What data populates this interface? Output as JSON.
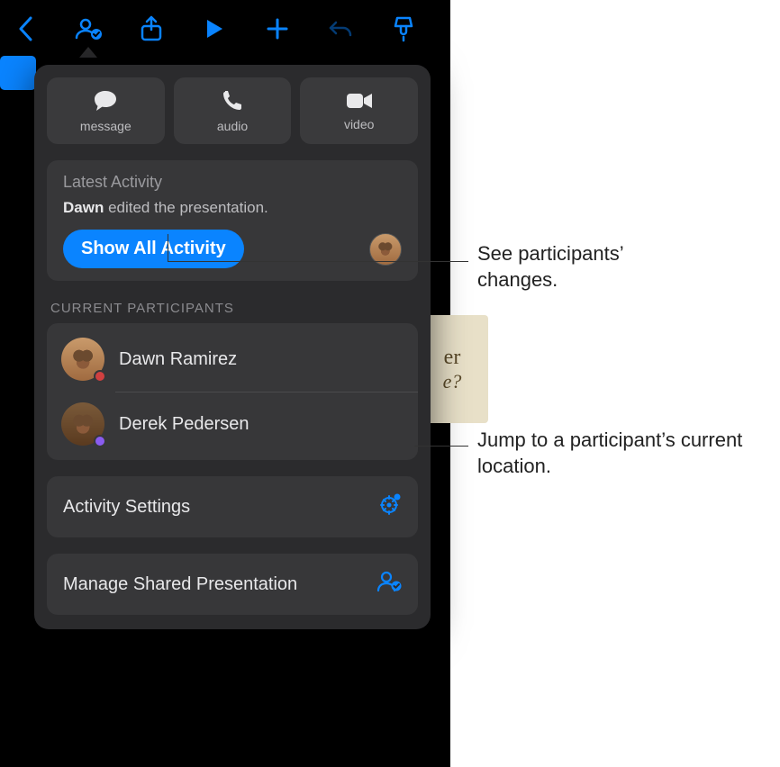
{
  "toolbar": {
    "back": "back",
    "collab": "collaboration",
    "share": "share",
    "play": "play",
    "add": "add",
    "undo": "undo",
    "format": "format-brush"
  },
  "popover": {
    "comms": [
      {
        "id": "message",
        "label": "message"
      },
      {
        "id": "audio",
        "label": "audio"
      },
      {
        "id": "video",
        "label": "video"
      }
    ],
    "latest_header": "Latest Activity",
    "latest_who": "Dawn",
    "latest_rest": " edited the presentation.",
    "show_all": "Show All Activity",
    "participants_header": "CURRENT PARTICIPANTS",
    "participants": [
      {
        "name": "Dawn Ramirez",
        "dot": "red"
      },
      {
        "name": "Derek Pedersen",
        "dot": "purple"
      }
    ],
    "activity_settings": "Activity Settings",
    "manage_shared": "Manage Shared Presentation"
  },
  "bg": {
    "line1": "er",
    "line2": "e?"
  },
  "callouts": {
    "c1": "See participants’ changes.",
    "c2": "Jump to a participant’s current location."
  }
}
